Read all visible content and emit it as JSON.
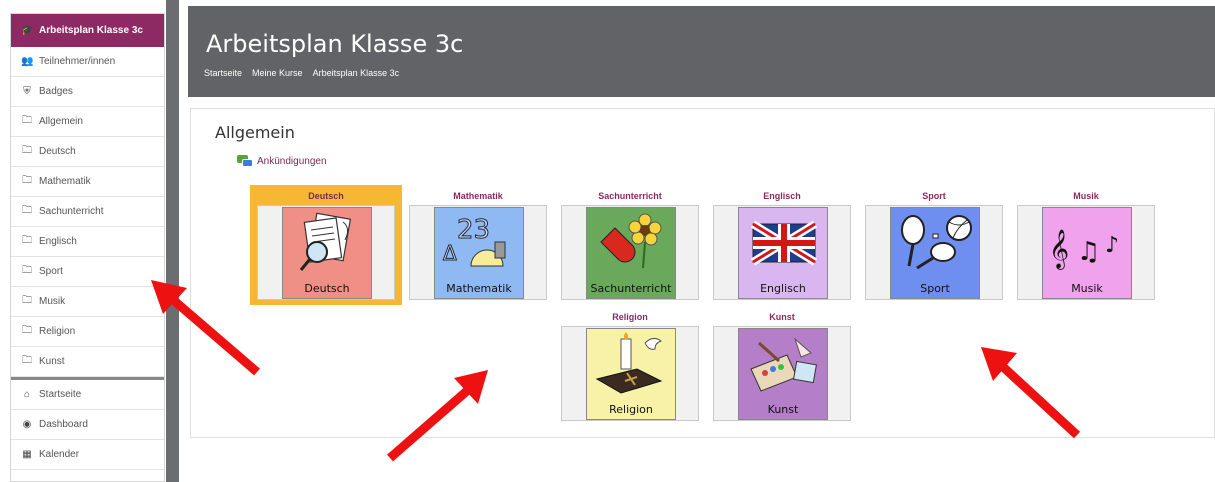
{
  "sidebar": {
    "items": [
      {
        "label": "Arbeitsplan Klasse 3c",
        "icon": "graduation-cap-icon",
        "glyph": "🎓"
      },
      {
        "label": "Teilnehmer/innen",
        "icon": "users-icon",
        "glyph": "👥"
      },
      {
        "label": "Badges",
        "icon": "shield-icon",
        "glyph": "⛨"
      },
      {
        "label": "Allgemein",
        "icon": "folder-icon",
        "glyph": "🗀"
      },
      {
        "label": "Deutsch",
        "icon": "folder-icon",
        "glyph": "🗀"
      },
      {
        "label": "Mathematik",
        "icon": "folder-icon",
        "glyph": "🗀"
      },
      {
        "label": "Sachunterricht",
        "icon": "folder-icon",
        "glyph": "🗀"
      },
      {
        "label": "Englisch",
        "icon": "folder-icon",
        "glyph": "🗀"
      },
      {
        "label": "Sport",
        "icon": "folder-icon",
        "glyph": "🗀"
      },
      {
        "label": "Musik",
        "icon": "folder-icon",
        "glyph": "🗀"
      },
      {
        "label": "Religion",
        "icon": "folder-icon",
        "glyph": "🗀"
      },
      {
        "label": "Kunst",
        "icon": "folder-icon",
        "glyph": "🗀"
      }
    ],
    "bottom_items": [
      {
        "label": "Startseite",
        "icon": "home-icon",
        "glyph": "⌂"
      },
      {
        "label": "Dashboard",
        "icon": "dashboard-icon",
        "glyph": "◉"
      },
      {
        "label": "Kalender",
        "icon": "calendar-icon",
        "glyph": "▦"
      }
    ]
  },
  "header": {
    "title": "Arbeitsplan Klasse 3c",
    "breadcrumb": [
      "Startseite",
      "Meine Kurse",
      "Arbeitsplan Klasse 3c"
    ]
  },
  "main": {
    "section_title": "Allgemein",
    "announcement": "Ankündigungen",
    "tiles": [
      {
        "title": "Deutsch",
        "label": "Deutsch",
        "bg": "#f08f86",
        "icon": "deutsch-picture-icon"
      },
      {
        "title": "Mathematik",
        "label": "Mathematik",
        "bg": "#8eb9f2",
        "icon": "mathematik-picture-icon"
      },
      {
        "title": "Sachunterricht",
        "label": "Sachunterricht",
        "bg": "#6aa85c",
        "icon": "sachunterricht-picture-icon"
      },
      {
        "title": "Englisch",
        "label": "Englisch",
        "bg": "#d9b6f0",
        "icon": "englisch-picture-icon"
      },
      {
        "title": "Sport",
        "label": "Sport",
        "bg": "#6f8ff0",
        "icon": "sport-picture-icon"
      },
      {
        "title": "Musik",
        "label": "Musik",
        "bg": "#f0a3ec",
        "icon": "musik-picture-icon"
      },
      {
        "title": "Religion",
        "label": "Religion",
        "bg": "#f7f2a8",
        "icon": "religion-picture-icon"
      },
      {
        "title": "Kunst",
        "label": "Kunst",
        "bg": "#b57ec9",
        "icon": "kunst-picture-icon"
      }
    ]
  },
  "colors": {
    "accent": "#8e2a63",
    "header_bg": "#626366",
    "highlight": "#f6b832",
    "arrow": "#ee1111"
  }
}
